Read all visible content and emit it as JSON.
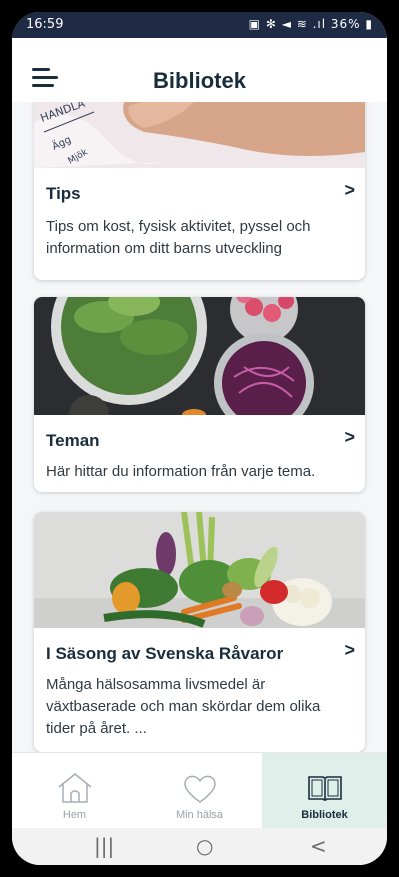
{
  "status": {
    "time": "16:59",
    "icons": "▣ ✻ ◄ ≋ .ıl 36% ▮"
  },
  "appbar": {
    "title": "Bibliotek"
  },
  "cards": [
    {
      "title": "Tips",
      "desc": "Tips om kost, fysisk aktivitet, pyssel och information om ditt barns utveckling"
    },
    {
      "title": "Teman",
      "desc": "Här hittar du information från varje tema."
    },
    {
      "title": "I Säsong av Svenska Råvaror",
      "desc": "Många hälsosamma livsmedel är växtbaserade och man skördar dem olika tider på året. ..."
    }
  ],
  "nav": [
    {
      "label": "Hem",
      "icon": "home-icon"
    },
    {
      "label": "Min hälsa",
      "icon": "heart-icon"
    },
    {
      "label": "Bibliotek",
      "icon": "book-icon",
      "active": true
    }
  ],
  "sysnav": {
    "recent": "|||",
    "home": "○",
    "back": "<"
  },
  "colors": {
    "accent": "#dff0ea",
    "text": "#1a2d3c",
    "statusbar": "#1f2a44"
  }
}
